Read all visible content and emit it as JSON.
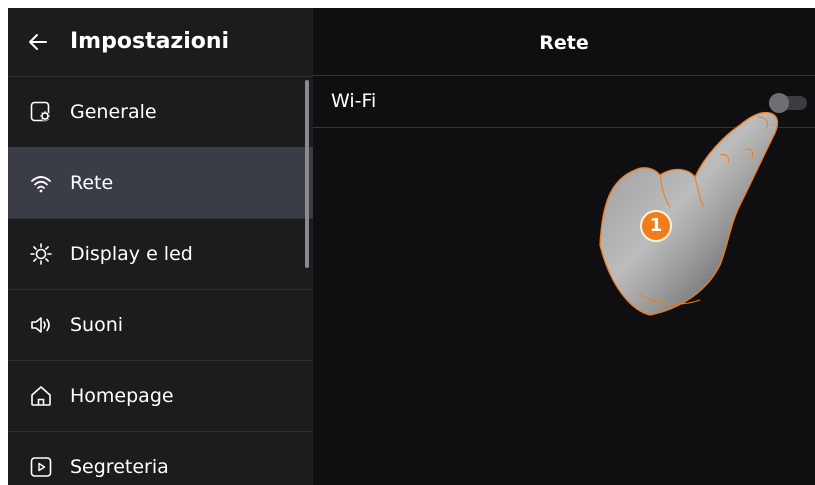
{
  "sidebar": {
    "title": "Impostazioni",
    "back_icon": "arrow-left-icon",
    "items": [
      {
        "label": "Generale",
        "icon": "settings-device-icon",
        "active": false
      },
      {
        "label": "Rete",
        "icon": "wifi-icon",
        "active": true
      },
      {
        "label": "Display e led",
        "icon": "brightness-icon",
        "active": false
      },
      {
        "label": "Suoni",
        "icon": "speaker-icon",
        "active": false
      },
      {
        "label": "Homepage",
        "icon": "home-icon",
        "active": false
      },
      {
        "label": "Segreteria",
        "icon": "play-box-icon",
        "active": false
      }
    ]
  },
  "main": {
    "title": "Rete",
    "wifi": {
      "label": "Wi-Fi",
      "enabled": false
    }
  },
  "annotation": {
    "step": "1",
    "color": "#f07d1a"
  },
  "colors": {
    "background": "#0f0f12",
    "sidebar": "#1c1c1e",
    "active_item": "#3a3c46"
  }
}
